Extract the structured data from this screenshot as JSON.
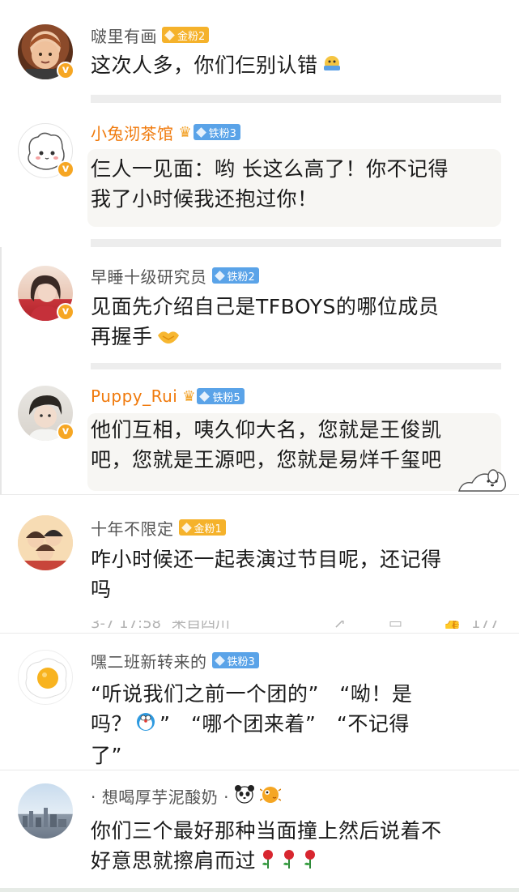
{
  "comments": [
    {
      "username": "啵里有画",
      "badge": "金粉2",
      "text": "这次人多，你们仨别认错",
      "avatar": "child-photo-avatar"
    },
    {
      "username": "小兔沏茶馆",
      "badge": "铁粉3",
      "text_line1": "仨人一见面：哟 长这么高了！你不记得",
      "text_line2": "我了小时候我还抱过你！",
      "avatar": "cartoon-sheep-avatar"
    },
    {
      "username": "早睡十级研究员",
      "badge": "铁粉2",
      "text_line1": "见面先介绍自己是TFBOYS的哪位成员",
      "text_line2": "再握手",
      "avatar": "girl-red-dress-avatar"
    },
    {
      "username": "Puppy_Rui",
      "badge": "铁粉5",
      "text_line1": "他们互相，咦久仰大名，您就是王俊凯",
      "text_line2": "吧，您就是王源吧，您就是易烊千玺吧",
      "avatar": "boy-photo-avatar"
    },
    {
      "username": "十年不限定",
      "badge": "金粉1",
      "text_line1": "咋小时候还一起表演过节目呢，还记得",
      "text_line2": "吗",
      "meta_time": "3-7 17:58",
      "meta_location": "来自四川",
      "meta_likes": "177",
      "avatar": "cartoon-group-avatar"
    },
    {
      "username": "嘿二班新转来的",
      "badge": "铁粉3",
      "text_line1": "“听说我们之前一个团的”　“呦！是",
      "text_line2a": "吗？",
      "text_line2b": "”　“哪个团来着”　“不记得",
      "text_line3": "了”",
      "avatar": "fried-egg-avatar"
    },
    {
      "username": "· 想喝厚芋泥酸奶 ·",
      "text_line1": "你们三个最好那种当面撞上然后说着不",
      "text_line2": "好意思就擦肩而过",
      "avatar": "city-skyline-avatar"
    }
  ],
  "colors": {
    "username_gray": "#555555",
    "username_orange": "#f07a0c",
    "gold_badge": "#f5b22b",
    "iron_badge": "#5aa3e8",
    "verified": "#f6a623"
  }
}
